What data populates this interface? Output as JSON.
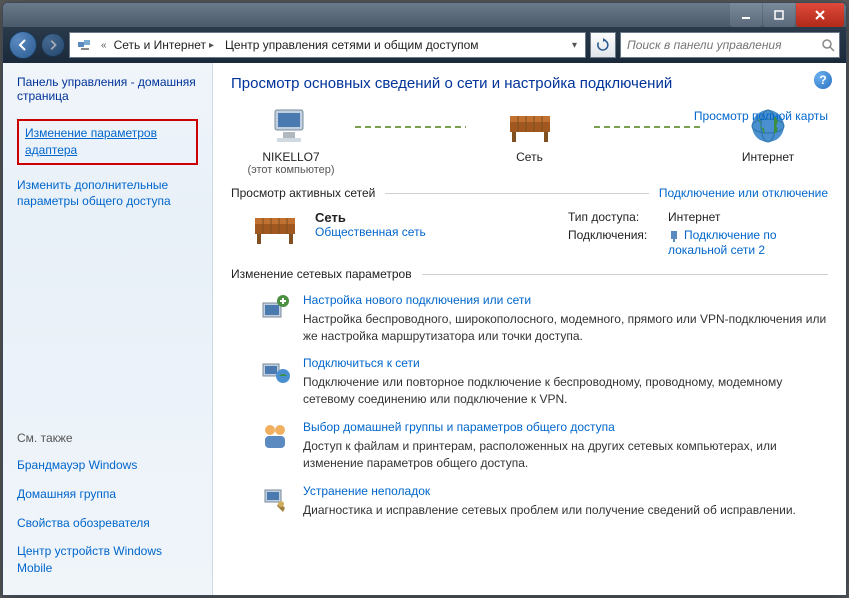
{
  "titlebar": {},
  "address": {
    "segments": [
      "Сеть и Интернет",
      "Центр управления сетями и общим доступом"
    ],
    "search_placeholder": "Поиск в панели управления"
  },
  "sidebar": {
    "home": "Панель управления - домашняя страница",
    "links": [
      "Изменение параметров адаптера",
      "Изменить дополнительные параметры общего доступа"
    ],
    "see_also_label": "См. также",
    "see_also": [
      "Брандмауэр Windows",
      "Домашняя группа",
      "Свойства обозревателя",
      "Центр устройств Windows Mobile"
    ]
  },
  "main": {
    "heading": "Просмотр основных сведений о сети и настройка подключений",
    "map_link": "Просмотр полной карты",
    "nodes": {
      "computer": "NIKELLO7",
      "computer_sub": "(этот компьютер)",
      "network": "Сеть",
      "internet": "Интернет"
    },
    "active_label": "Просмотр активных сетей",
    "active_action": "Подключение или отключение",
    "active_net": {
      "name": "Сеть",
      "type": "Общественная сеть",
      "access_label": "Тип доступа:",
      "access_value": "Интернет",
      "conn_label": "Подключения:",
      "conn_value": "Подключение по локальной сети 2"
    },
    "change_label": "Изменение сетевых параметров",
    "tasks": [
      {
        "title": "Настройка нового подключения или сети",
        "desc": "Настройка беспроводного, широкополосного, модемного, прямого или VPN-подключения или же настройка маршрутизатора или точки доступа."
      },
      {
        "title": "Подключиться к сети",
        "desc": "Подключение или повторное подключение к беспроводному, проводному, модемному сетевому соединению или подключение к VPN."
      },
      {
        "title": "Выбор домашней группы и параметров общего доступа",
        "desc": "Доступ к файлам и принтерам, расположенных на других сетевых компьютерах, или изменение параметров общего доступа."
      },
      {
        "title": "Устранение неполадок",
        "desc": "Диагностика и исправление сетевых проблем или получение сведений об исправлении."
      }
    ]
  }
}
